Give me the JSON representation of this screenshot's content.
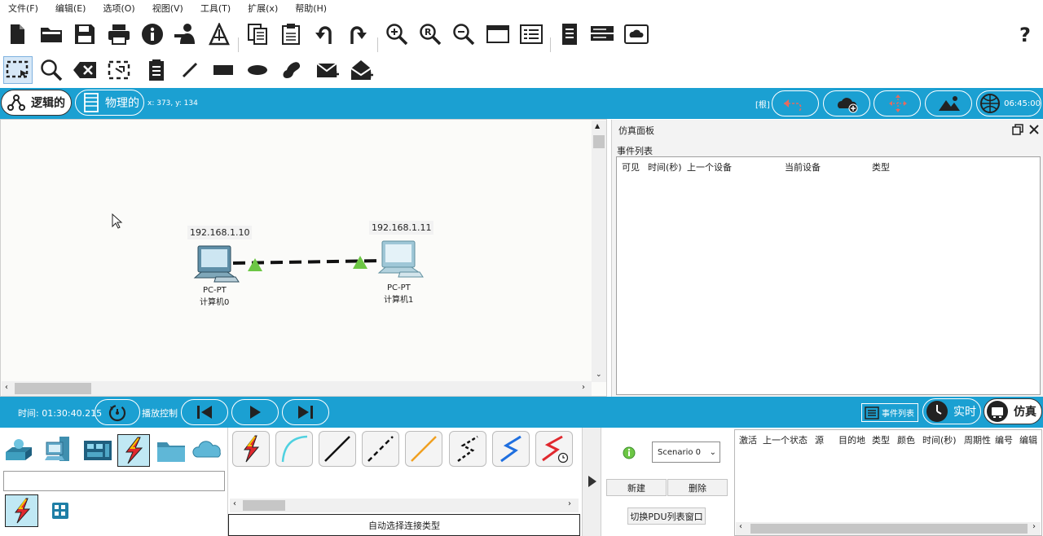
{
  "menu": [
    "文件(F)",
    "编辑(E)",
    "选项(O)",
    "视图(V)",
    "工具(T)",
    "扩展(x)",
    "帮助(H)"
  ],
  "toolbar1_icons": [
    "new-file-icon",
    "open-folder-icon",
    "save-icon",
    "print-icon",
    "info-icon",
    "activity-wizard-icon",
    "network-info-icon",
    "copy-icon",
    "paste-icon",
    "undo-icon",
    "redo-icon",
    "zoom-in-icon",
    "zoom-reset-icon",
    "zoom-out-icon",
    "window-icon",
    "palette-icon",
    "notes-icon",
    "device-template-icon",
    "cloud-screen-icon",
    "help-icon"
  ],
  "toolbar2_icons": [
    "select-icon",
    "inspect-icon",
    "delete-icon",
    "resize-icon",
    "note-icon",
    "line-icon",
    "rectangle-icon",
    "ellipse-icon",
    "freeform-icon",
    "simple-pdu-icon",
    "complex-pdu-icon"
  ],
  "modebar": {
    "logical_label": "逻辑的",
    "physical_label": "物理的",
    "coords": "x: 373, y: 134",
    "root_label": "[根]",
    "clock": "06:45:00"
  },
  "topology": {
    "pc0": {
      "ip": "192.168.1.10",
      "model": "PC-PT",
      "name": "计算机0"
    },
    "pc1": {
      "ip": "192.168.1.11",
      "model": "PC-PT",
      "name": "计算机1"
    }
  },
  "sim_panel": {
    "title": "仿真面板",
    "event_list_label": "事件列表",
    "columns": [
      "可见",
      "时间(秒)",
      "上一个设备",
      "当前设备",
      "类型"
    ]
  },
  "bottombar": {
    "time": "时间: 01:30:40.215",
    "playback_label": "播放控制",
    "event_list_btn": "事件列表",
    "realtime_label": "实时",
    "simulation_label": "仿真"
  },
  "devices": {
    "search_placeholder": "",
    "connection_hint": "自动选择连接类型"
  },
  "scenario": {
    "selected": "Scenario 0",
    "new_label": "新建",
    "delete_label": "删除",
    "toggle_label": "切换PDU列表窗口"
  },
  "pdu_columns": [
    "激活",
    "上一个状态",
    "源",
    "目的地",
    "类型",
    "颜色",
    "时间(秒)",
    "周期性",
    "编号",
    "编辑"
  ],
  "colors": {
    "accent": "#1ba0d2",
    "link_up": "#6cc644",
    "lightning": "#e0282e"
  }
}
